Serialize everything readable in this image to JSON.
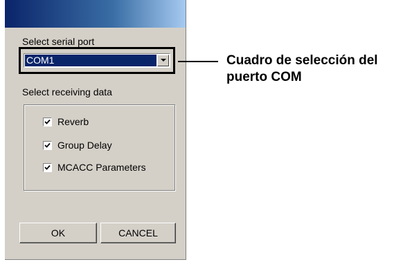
{
  "dialog": {
    "serial_port_label": "Select serial port",
    "serial_port_value": "COM1",
    "receiving_label": "Select receiving data",
    "options": [
      {
        "label": "Reverb",
        "checked": true
      },
      {
        "label": "Group Delay",
        "checked": true
      },
      {
        "label": "MCACC Parameters",
        "checked": true
      }
    ],
    "ok_label": "OK",
    "cancel_label": "CANCEL"
  },
  "callout": {
    "line1": "Cuadro de selección del",
    "line2": "puerto COM"
  },
  "colors": {
    "dialog_bg": "#d4d0c8",
    "selection": "#0a246a",
    "titlebar": "#0a246a"
  }
}
